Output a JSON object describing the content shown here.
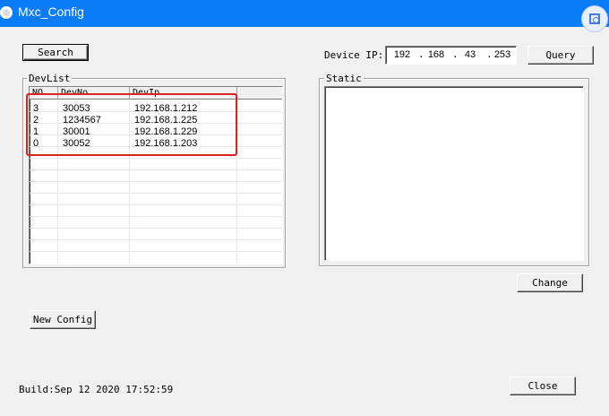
{
  "window": {
    "title": "Mxc_Config"
  },
  "buttons": {
    "search": "Search",
    "query": "Query",
    "change": "Change",
    "new_config": "New Config",
    "close": "Close"
  },
  "device_ip": {
    "label": "Device IP:",
    "octets": [
      "192",
      "168",
      "43",
      "253"
    ]
  },
  "devlist": {
    "label": "DevList",
    "columns": [
      "NO",
      "DevNo",
      "DevIp"
    ],
    "rows": [
      {
        "no": "3",
        "devno": "30053",
        "devip": "192.168.1.212"
      },
      {
        "no": "2",
        "devno": "1234567",
        "devip": "192.168.1.225"
      },
      {
        "no": "1",
        "devno": "30001",
        "devip": "192.168.1.229"
      },
      {
        "no": "0",
        "devno": "30052",
        "devip": "192.168.1.203"
      }
    ]
  },
  "static_group": {
    "label": "Static"
  },
  "build": {
    "text": "Build:Sep 12 2020 17:52:59"
  },
  "colors": {
    "titlebar": "#0a7cf5",
    "highlight": "#e02020"
  }
}
